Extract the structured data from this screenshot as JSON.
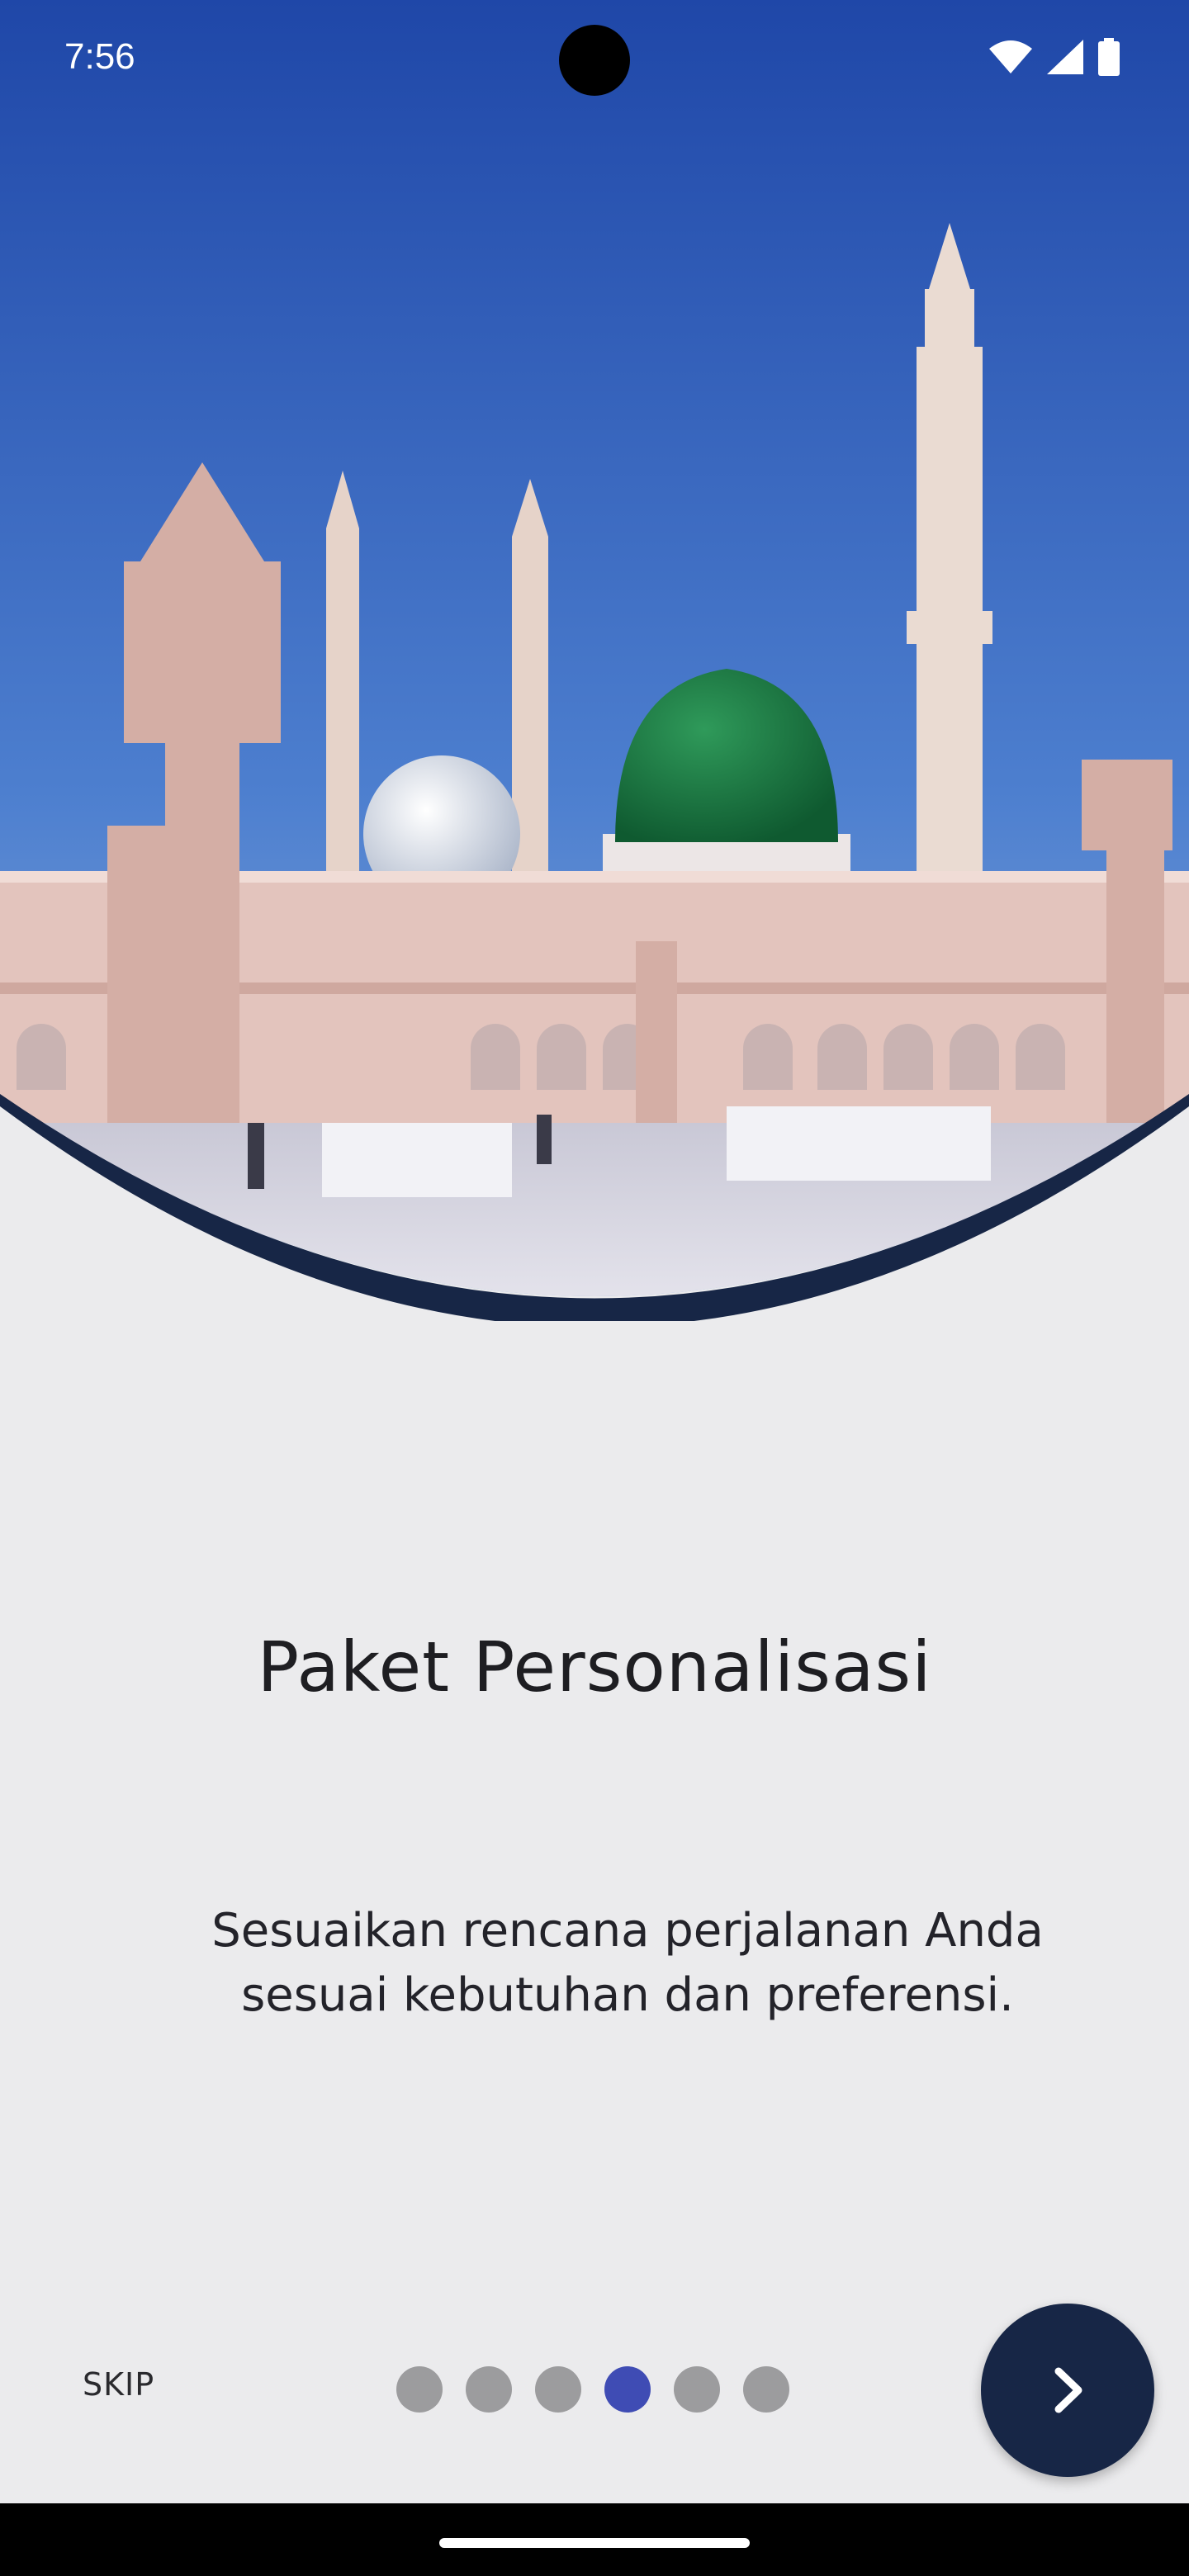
{
  "status_bar": {
    "time": "7:56",
    "icons": [
      "wifi-icon",
      "cell-signal-icon",
      "battery-icon"
    ]
  },
  "hero": {
    "image": "mosque-with-green-dome-photo",
    "accent_color": "#172646"
  },
  "onboarding": {
    "title": "Paket Personalisasi",
    "description": "Sesuaikan rencana perjalanan Anda sesuai kebutuhan dan preferensi.",
    "skip_label": "SKIP",
    "page_count": 6,
    "active_page": 4,
    "next_icon": "chevron-right-icon"
  },
  "colors": {
    "background": "#ebebed",
    "dot_inactive": "#9c9c9e",
    "dot_active": "#3f4cb4",
    "button": "#172646"
  }
}
